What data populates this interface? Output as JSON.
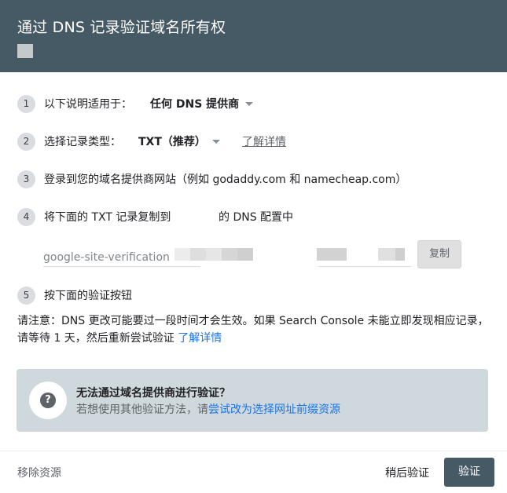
{
  "header": {
    "title": "通过 DNS 记录验证域名所有权"
  },
  "steps": [
    {
      "number": "1",
      "label": "以下说明适用于：",
      "dropdown_value": "任何 DNS 提供商"
    },
    {
      "number": "2",
      "label": "选择记录类型：",
      "dropdown_value": "TXT（推荐）",
      "link": "了解详情"
    },
    {
      "number": "3",
      "label": "登录到您的域名提供商网站（例如 godaddy.com 和 namecheap.com）"
    },
    {
      "number": "4",
      "label": "将下面的 TXT 记录复制到",
      "suffix": "的 DNS 配置中"
    },
    {
      "number": "5",
      "label": "按下面的验证按钮"
    }
  ],
  "record": {
    "value_prefix": "google-site-verification",
    "copy_label": "复制"
  },
  "note": {
    "text": "请注意：DNS 更改可能要过一段时间才会生效。如果 Search Console 未能立即发现相应记录，请等待 1 天，然后重新尝试验证",
    "link": "了解详情"
  },
  "alternative": {
    "icon_glyph": "?",
    "title": "无法通过域名提供商进行验证？",
    "desc": "若想使用其他验证方法，请",
    "link": "尝试改为选择网址前缀资源"
  },
  "footer": {
    "remove_label": "移除资源",
    "later_label": "稍后验证",
    "verify_label": "验证"
  },
  "colors": {
    "header_bg": "#455a64",
    "link_blue": "#1a73e8",
    "alt_box_bg": "#cfd8dc"
  }
}
